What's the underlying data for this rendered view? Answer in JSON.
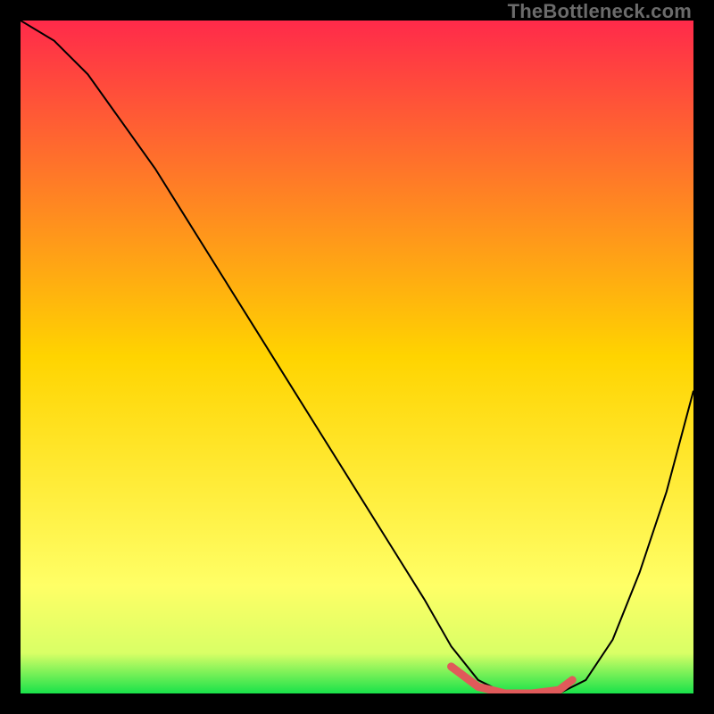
{
  "watermark": "TheBottleneck.com",
  "chart_data": {
    "type": "line",
    "title": "",
    "xlabel": "",
    "ylabel": "",
    "xrange": [
      0,
      100
    ],
    "yrange": [
      0,
      100
    ],
    "gradient_stops": [
      {
        "offset": 0,
        "color": "#ff2a4a"
      },
      {
        "offset": 50,
        "color": "#ffd400"
      },
      {
        "offset": 84,
        "color": "#ffff66"
      },
      {
        "offset": 94,
        "color": "#d9ff66"
      },
      {
        "offset": 100,
        "color": "#19e24a"
      }
    ],
    "series": [
      {
        "name": "bottleneck-curve",
        "color": "#000000",
        "x": [
          0,
          5,
          10,
          15,
          20,
          25,
          30,
          35,
          40,
          45,
          50,
          55,
          60,
          64,
          68,
          72,
          76,
          80,
          84,
          88,
          92,
          96,
          100
        ],
        "y": [
          100,
          97,
          92,
          85,
          78,
          70,
          62,
          54,
          46,
          38,
          30,
          22,
          14,
          7,
          2,
          0,
          0,
          0,
          2,
          8,
          18,
          30,
          45
        ]
      },
      {
        "name": "optimal-band",
        "color": "#e05a5a",
        "x": [
          64,
          68,
          72,
          76,
          80,
          82
        ],
        "y": [
          4,
          1,
          0,
          0,
          0.5,
          2
        ]
      }
    ]
  }
}
